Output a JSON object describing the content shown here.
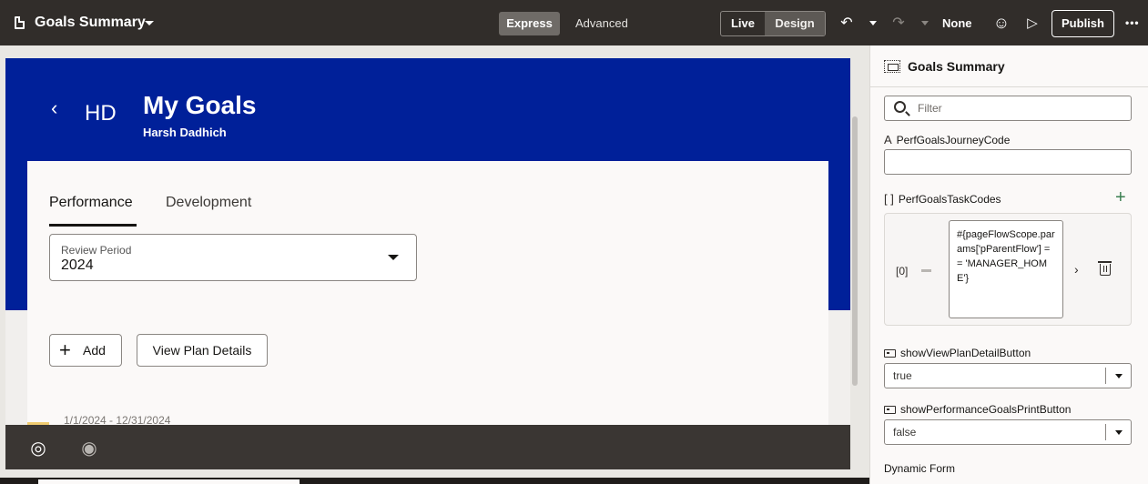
{
  "header": {
    "app_title": "Goals Summary",
    "mode_express": "Express",
    "mode_advanced": "Advanced",
    "view_live": "Live",
    "view_design": "Design",
    "language": "None",
    "publish": "Publish",
    "more": "•••"
  },
  "canvas": {
    "back": "‹",
    "initials": "HD",
    "title": "My Goals",
    "subtitle": "Harsh Dadhich",
    "tabs": [
      "Performance",
      "Development"
    ],
    "review_label": "Review Period",
    "review_value": "2024",
    "add_label": "Add",
    "plus": "+",
    "view_plan": "View Plan Details",
    "date_range": "1/1/2024 - 12/31/2024"
  },
  "panel": {
    "title": "Goals Summary",
    "filter_placeholder": "Filter",
    "journey_code_label": "PerfGoalsJourneyCode",
    "journey_code_icon": "A",
    "task_codes_label": "PerfGoalsTaskCodes",
    "task_codes_icon": "[ ]",
    "add_icon": "+",
    "array_index": "[0]",
    "expression": "#{pageFlowScope.params['pParentFlow'] == 'MANAGER_HOME'}",
    "chevron": "›",
    "view_plan_prop": "showViewPlanDetailButton",
    "view_plan_value": "true",
    "print_prop": "showPerformanceGoalsPrintButton",
    "print_value": "false",
    "dynamic_form": "Dynamic Form"
  },
  "icons": {
    "undo": "↶",
    "redo": "↷",
    "smile": "☺",
    "play": "▷",
    "goal": "◎",
    "eye": "◉"
  },
  "colors": {
    "topbar": "#312d2a",
    "hero": "#002099",
    "accent_green": "#3a7f51"
  }
}
